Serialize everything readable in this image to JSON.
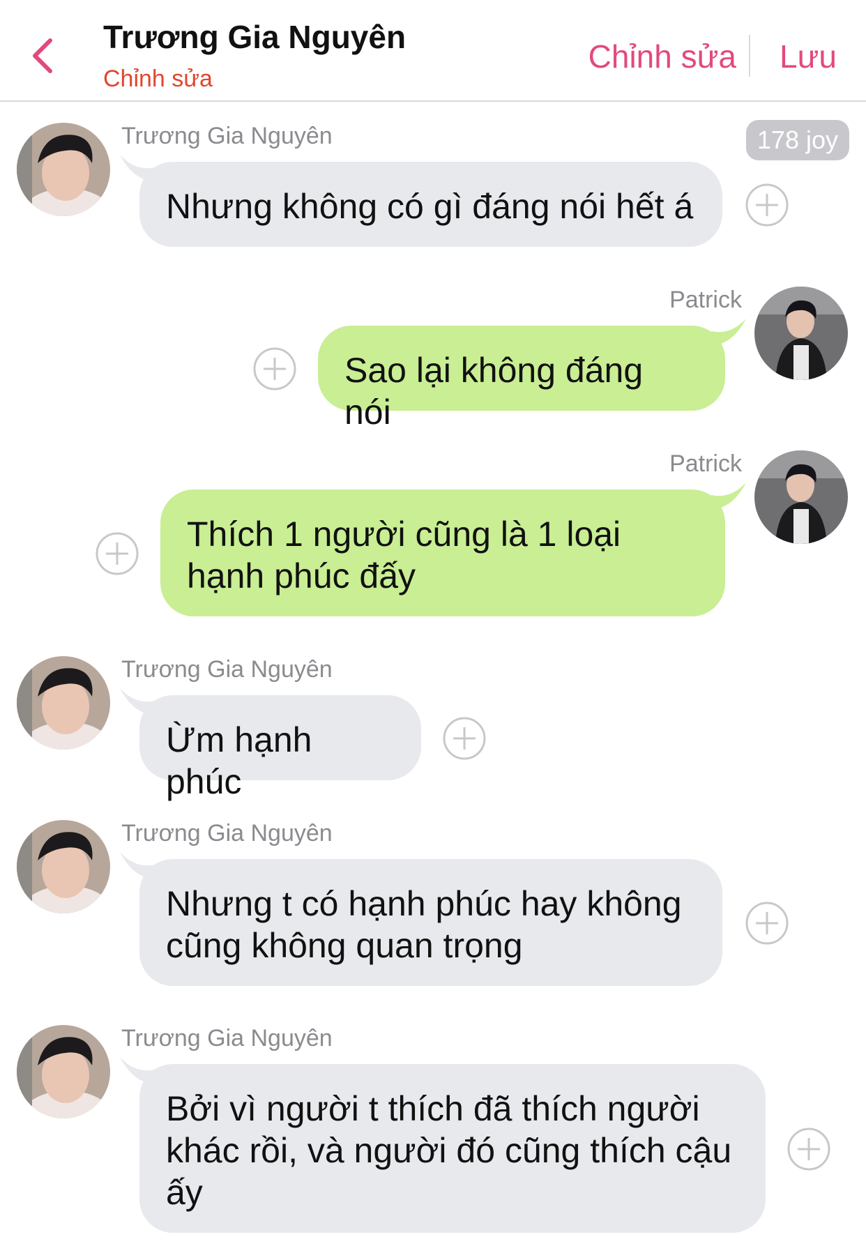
{
  "header": {
    "title": "Trương Gia Nguyên",
    "subtitle": "Chỉnh sửa",
    "edit_label": "Chỉnh sửa",
    "save_label": "Lưu",
    "accent_color": "#e24a7c"
  },
  "badge": {
    "text": "178 joy"
  },
  "messages": [
    {
      "sender": "Trương Gia Nguyên",
      "side": "in",
      "text": "Nhưng không có gì đáng nói hết á"
    },
    {
      "sender": "Patrick",
      "side": "out",
      "text": "Sao lại không đáng nói"
    },
    {
      "sender": "Patrick",
      "side": "out",
      "text": "Thích 1 người cũng là 1 loại hạnh phúc đấy"
    },
    {
      "sender": "Trương Gia Nguyên",
      "side": "in",
      "text": "Ừm hạnh phúc"
    },
    {
      "sender": "Trương Gia Nguyên",
      "side": "in",
      "text": "Nhưng t có hạnh phúc hay không cũng không quan trọng"
    },
    {
      "sender": "Trương Gia Nguyên",
      "side": "in",
      "text": "Bởi vì người t thích đã thích người khác rồi, và người đó cũng thích cậu ấy"
    }
  ],
  "colors": {
    "incoming_bubble": "#e8e9ed",
    "outgoing_bubble": "#c9ee94",
    "subtitle": "#e0472e"
  },
  "icons": {
    "back": "chevron-left-icon",
    "add": "plus-circle-icon"
  }
}
